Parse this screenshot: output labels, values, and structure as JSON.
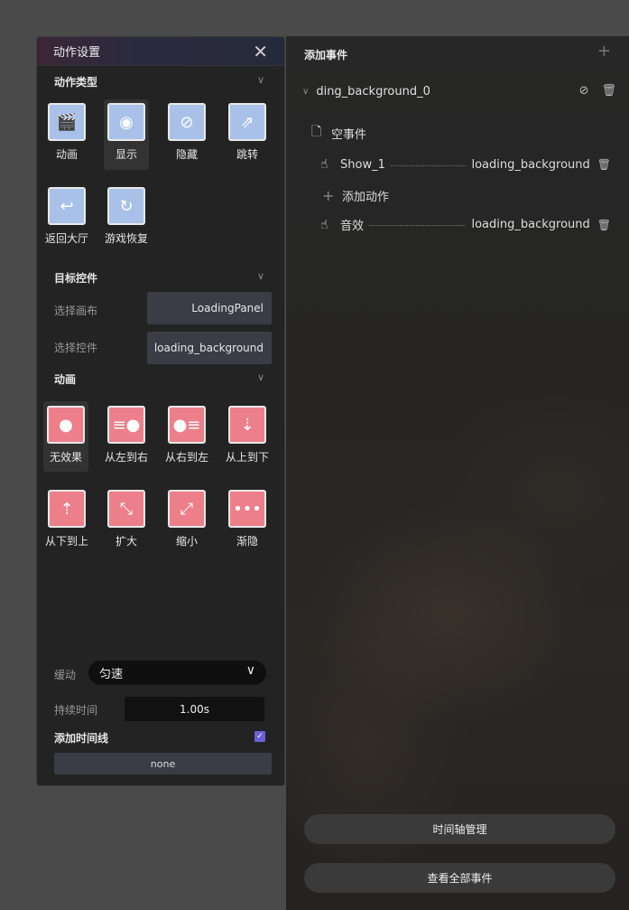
{
  "action_panel": {
    "title": "动作设置",
    "sections": {
      "action_type": "动作类型",
      "target_control": "目标控件",
      "animation": "动画"
    },
    "action_types": [
      {
        "label": "动画",
        "icon": "clapperboard-icon"
      },
      {
        "label": "显示",
        "icon": "eye-icon",
        "selected": true
      },
      {
        "label": "隐藏",
        "icon": "eye-off-icon"
      },
      {
        "label": "跳转",
        "icon": "external-link-icon"
      },
      {
        "label": "返回大厅",
        "icon": "return-icon"
      },
      {
        "label": "游戏恢复",
        "icon": "restore-icon"
      }
    ],
    "canvas_label": "选择画布",
    "canvas_value": "LoadingPanel",
    "control_label": "选择控件",
    "control_value": "loading_background",
    "animations": [
      {
        "label": "无效果",
        "icon": "dot-icon",
        "selected": true
      },
      {
        "label": "从左到右",
        "icon": "slide-right-icon"
      },
      {
        "label": "从右到左",
        "icon": "slide-left-icon"
      },
      {
        "label": "从上到下",
        "icon": "slide-down-icon"
      },
      {
        "label": "从下到上",
        "icon": "slide-up-icon"
      },
      {
        "label": "扩大",
        "icon": "expand-icon"
      },
      {
        "label": "缩小",
        "icon": "shrink-icon"
      },
      {
        "label": "渐隐",
        "icon": "fade-icon"
      }
    ],
    "ease_label": "缓动",
    "ease_value": "匀速",
    "duration_label": "持续时间",
    "duration_value": "1.00s",
    "timeline_label": "添加时间线",
    "timeline_checked": true,
    "timeline_value": "none"
  },
  "events_panel": {
    "title": "添加事件",
    "target_name": "ding_background_0",
    "empty_event": "空事件",
    "actions": [
      {
        "name": "Show_1",
        "target": "loading_background"
      },
      {
        "name": "音效",
        "target": "loading_background"
      }
    ],
    "add_action": "添加动作",
    "timeline_button": "时间轴管理",
    "all_events_button": "查看全部事件"
  },
  "colors": {
    "accent_checkbox": "#6b5fd6",
    "action_tile_blue": "#a9c1e8",
    "anim_tile_pink": "#ec7f8a"
  }
}
